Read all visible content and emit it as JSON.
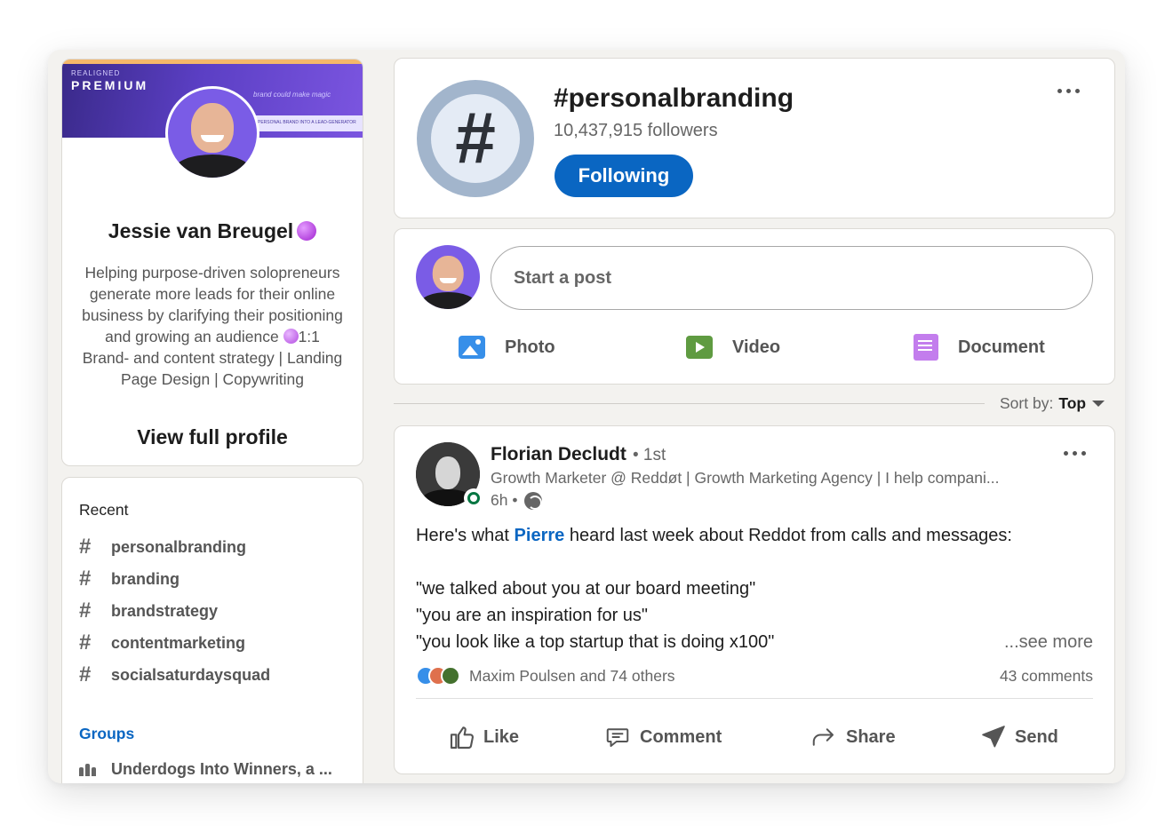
{
  "profile": {
    "banner_brand": "REALIGNED",
    "banner_premium": "PREMIUM",
    "banner_faint": "brand could make magic",
    "banner_strip": "PERSONAL BRAND INTO A LEAD-GENERATOR",
    "name": "Jessie van Breugel",
    "headline": "Helping purpose-driven solopreneurs generate more leads for their online business by clarifying their positioning and growing an audience",
    "headline_tail": "1:1 Brand- and content strategy | Landing Page Design | Copywriting",
    "view_profile": "View full profile"
  },
  "recent": {
    "title": "Recent",
    "items": [
      {
        "label": "personalbranding"
      },
      {
        "label": "branding"
      },
      {
        "label": "brandstrategy"
      },
      {
        "label": "contentmarketing"
      },
      {
        "label": "socialsaturdaysquad"
      }
    ],
    "groups_title": "Groups",
    "group_item": "Underdogs Into Winners, a ..."
  },
  "hashtag": {
    "symbol": "#",
    "title": "#personalbranding",
    "followers": "10,437,915 followers",
    "follow_label": "Following"
  },
  "composer": {
    "placeholder": "Start a post",
    "photo": "Photo",
    "video": "Video",
    "document": "Document"
  },
  "sort": {
    "label": "Sort by:",
    "value": "Top"
  },
  "post": {
    "author": "Florian Decludt",
    "degree": "• 1st",
    "description": "Growth Marketer @ Reddøt | Growth Marketing Agency | I help compani...",
    "time": "6h •",
    "line1_pre": "Here's what",
    "line1_mention": "Pierre",
    "line1_post": "heard last week about Reddot from calls and messages:",
    "quote1": "\"we talked about you at our board meeting\"",
    "quote2": "\"you are an inspiration for us\"",
    "quote3": "\"you look like a top startup that is doing x100\"",
    "see_more": "...see more",
    "reactions": "Maxim Poulsen and 74 others",
    "comments": "43 comments",
    "like": "Like",
    "comment": "Comment",
    "share": "Share",
    "send": "Send"
  },
  "colors": {
    "accent": "#0a66c2",
    "background": "#f3f2ef",
    "online": "#057642",
    "photo_icon": "#378fe9",
    "video_icon": "#5f9b41",
    "document_icon": "#c37ded"
  }
}
